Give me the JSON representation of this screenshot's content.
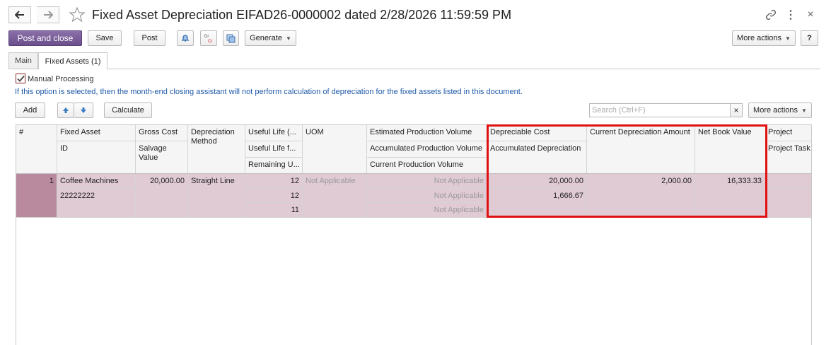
{
  "header": {
    "title": "Fixed Asset Depreciation EIFAD26-0000002 dated 2/28/2026 11:59:59 PM"
  },
  "toolbar": {
    "post_and_close": "Post and close",
    "save": "Save",
    "post": "Post",
    "generate": "Generate",
    "more_actions": "More actions",
    "help": "?"
  },
  "tabs": [
    {
      "label": "Main",
      "active": false
    },
    {
      "label": "Fixed Assets (1)",
      "active": true
    }
  ],
  "manual_processing": {
    "label": "Manual Processing",
    "checked": true,
    "info": "If this option is selected, then the month-end closing assistant will not perform calculation of depreciation for the fixed assets listed in this document."
  },
  "grid_toolbar": {
    "add": "Add",
    "calculate": "Calculate",
    "search_placeholder": "Search (Ctrl+F)",
    "more_actions": "More actions"
  },
  "grid": {
    "headers": {
      "num": "#",
      "fixed_asset": "Fixed Asset",
      "id": "ID",
      "gross_cost": "Gross Cost",
      "salvage_value": "Salvage Value",
      "depreciation_method": "Depreciation Method",
      "useful_life": "Useful Life (...",
      "useful_life_f": "Useful Life f...",
      "remaining_u": "Remaining U...",
      "uom": "UOM",
      "est_prod_volume": "Estimated Production Volume",
      "acc_prod_volume": "Accumulated Production Volume",
      "cur_prod_volume": "Current Production Volume",
      "depreciable_cost": "Depreciable Cost",
      "accumulated_depreciation": "Accumulated Depreciation",
      "current_depreciation_amount": "Current Depreciation Amount",
      "net_book_value": "Net Book Value",
      "project": "Project",
      "project_task": "Project Task"
    },
    "row": {
      "num": "1",
      "fixed_asset": "Coffee Machines",
      "id": "22222222",
      "gross_cost": "20,000.00",
      "depreciation_method": "Straight Line",
      "useful_life": "12",
      "useful_life_f": "12",
      "remaining_u": "11",
      "uom": "Not Applicable",
      "est_prod_volume": "Not Applicable",
      "acc_prod_volume": "Not Applicable",
      "cur_prod_volume": "Not Applicable",
      "depreciable_cost": "20,000.00",
      "accumulated_depreciation": "1,666.67",
      "current_depreciation_amount": "2,000.00",
      "net_book_value": "16,333.33"
    }
  },
  "colors": {
    "primary_button": "#6b4f8c",
    "row_highlight": "#e0cad4",
    "selected_cell": "#b98a9e",
    "highlight_box": "#e01010",
    "info_text": "#1f5aa8"
  }
}
